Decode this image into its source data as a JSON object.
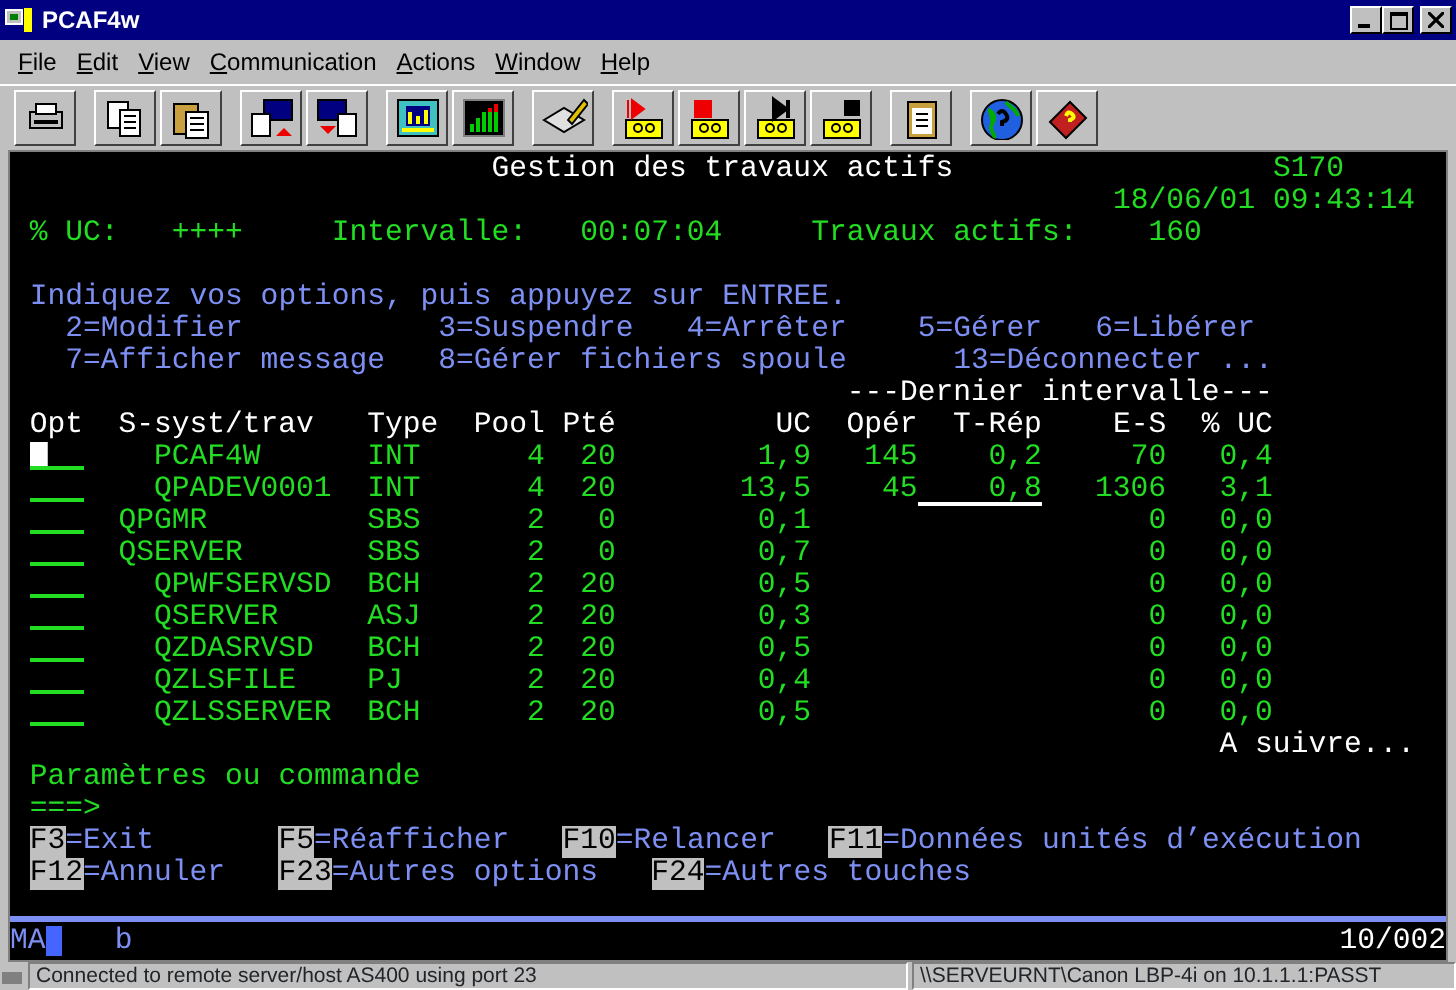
{
  "window": {
    "title": "PCAF4w"
  },
  "menu": [
    "File",
    "Edit",
    "View",
    "Communication",
    "Actions",
    "Window",
    "Help"
  ],
  "screen": {
    "title": "Gestion des travaux actifs",
    "system": "S170",
    "date": "18/06/01",
    "time": "09:43:14",
    "stats": [
      {
        "label": "% UC:",
        "value": "++++"
      },
      {
        "label": "Intervalle:",
        "value": "00:07:04"
      },
      {
        "label": "Travaux actifs:",
        "value": "160"
      }
    ],
    "instruction": "Indiquez vos options, puis appuyez sur ENTREE.",
    "option_lines": [
      [
        "2=Modifier",
        "3=Suspendre",
        "4=Arrêter",
        "5=Gérer",
        "6=Libérer"
      ],
      [
        "7=Afficher message",
        "8=Gérer fichiers spoule",
        "13=Déconnecter ..."
      ]
    ],
    "group_header": "---Dernier intervalle---",
    "columns": [
      "Opt",
      "S-syst/trav",
      "Type",
      "Pool",
      "Pté",
      "UC",
      "Opér",
      "T-Rép",
      "E-S",
      "% UC"
    ],
    "rows": [
      {
        "kind": "job",
        "cursor": true,
        "underlined": false,
        "name": "PCAF4W",
        "type": "INT",
        "pool": "4",
        "priority": "20",
        "cpu": "1,9",
        "ops": "145",
        "response": "0,2",
        "io": "70",
        "cpu_pct": "0,4"
      },
      {
        "kind": "job",
        "cursor": false,
        "underlined": true,
        "name": "QPADEV0001",
        "type": "INT",
        "pool": "4",
        "priority": "20",
        "cpu": "13,5",
        "ops": "45",
        "response": "0,8",
        "io": "1306",
        "cpu_pct": "3,1"
      },
      {
        "kind": "subsystem",
        "cursor": false,
        "underlined": false,
        "name": "QPGMR",
        "type": "SBS",
        "pool": "2",
        "priority": "0",
        "cpu": "0,1",
        "io": "0",
        "cpu_pct": "0,0"
      },
      {
        "kind": "subsystem",
        "cursor": false,
        "underlined": false,
        "name": "QSERVER",
        "type": "SBS",
        "pool": "2",
        "priority": "0",
        "cpu": "0,7",
        "io": "0",
        "cpu_pct": "0,0"
      },
      {
        "kind": "job",
        "cursor": false,
        "underlined": false,
        "name": "QPWFSERVSD",
        "type": "BCH",
        "pool": "2",
        "priority": "20",
        "cpu": "0,5",
        "io": "0",
        "cpu_pct": "0,0"
      },
      {
        "kind": "job",
        "cursor": false,
        "underlined": false,
        "name": "QSERVER",
        "type": "ASJ",
        "pool": "2",
        "priority": "20",
        "cpu": "0,3",
        "io": "0",
        "cpu_pct": "0,0"
      },
      {
        "kind": "job",
        "cursor": false,
        "underlined": false,
        "name": "QZDASRVSD",
        "type": "BCH",
        "pool": "2",
        "priority": "20",
        "cpu": "0,5",
        "io": "0",
        "cpu_pct": "0,0"
      },
      {
        "kind": "job",
        "cursor": false,
        "underlined": false,
        "name": "QZLSFILE",
        "type": "PJ",
        "pool": "2",
        "priority": "20",
        "cpu": "0,4",
        "io": "0",
        "cpu_pct": "0,0"
      },
      {
        "kind": "job",
        "cursor": false,
        "underlined": false,
        "name": "QZLSSERVER",
        "type": "BCH",
        "pool": "2",
        "priority": "20",
        "cpu": "0,5",
        "io": "0",
        "cpu_pct": "0,0"
      }
    ],
    "more": "A suivre...",
    "command": {
      "label": "Paramètres ou commande",
      "prompt": "===>"
    },
    "function_keys": [
      [
        {
          "key": "F3",
          "label": "=Exit"
        },
        {
          "key": "F5",
          "label": "=Réafficher"
        },
        {
          "key": "F10",
          "label": "=Relancer"
        },
        {
          "key": "F11",
          "label": "=Données unités d’exécution"
        }
      ],
      [
        {
          "key": "F12",
          "label": "=Annuler"
        },
        {
          "key": "F23",
          "label": "=Autres options"
        },
        {
          "key": "F24",
          "label": "=Autres touches"
        }
      ]
    ]
  },
  "oia": {
    "mode": "MA",
    "field": "b",
    "position": "10/002"
  },
  "status_bar": [
    "Connected to remote server/host AS400 using port 23",
    "\\\\SERVEURNT\\Canon LBP-4i on 10.1.1.1:PASST"
  ]
}
